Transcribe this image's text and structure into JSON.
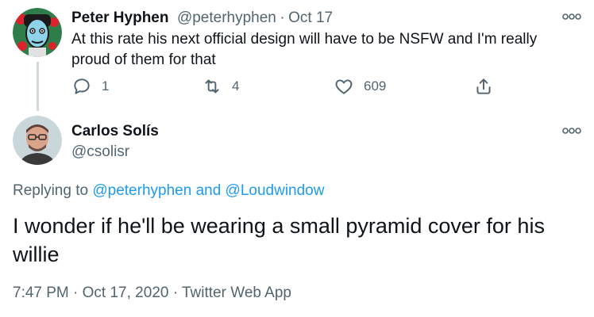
{
  "tweet1": {
    "author_name": "Peter Hyphen",
    "handle": "@peterhyphen",
    "separator": "·",
    "date": "Oct 17",
    "text": "At this rate his next official design will have to be NSFW and I'm really proud of them for that",
    "reply_count": "1",
    "retweet_count": "4",
    "like_count": "609",
    "icons": [
      "reply-icon",
      "retweet-icon",
      "like-icon",
      "share-icon",
      "more-icon"
    ]
  },
  "tweet2": {
    "author_name": "Carlos Solís",
    "handle": "@csolisr",
    "replying_prefix": "Replying to",
    "replying_user1": "@peterhyphen",
    "replying_and": "and",
    "replying_user2": "@Loudwindow",
    "text": "I wonder if he'll be wearing a small pyramid cover for his willie",
    "time": "7:47 PM",
    "separator1": "·",
    "date": "Oct 17, 2020",
    "separator2": "·",
    "source": "Twitter Web App"
  },
  "colors": {
    "text": "#0f1419",
    "muted": "#536471",
    "link": "#1d9bf0",
    "thread_line": "#cfd9de"
  }
}
